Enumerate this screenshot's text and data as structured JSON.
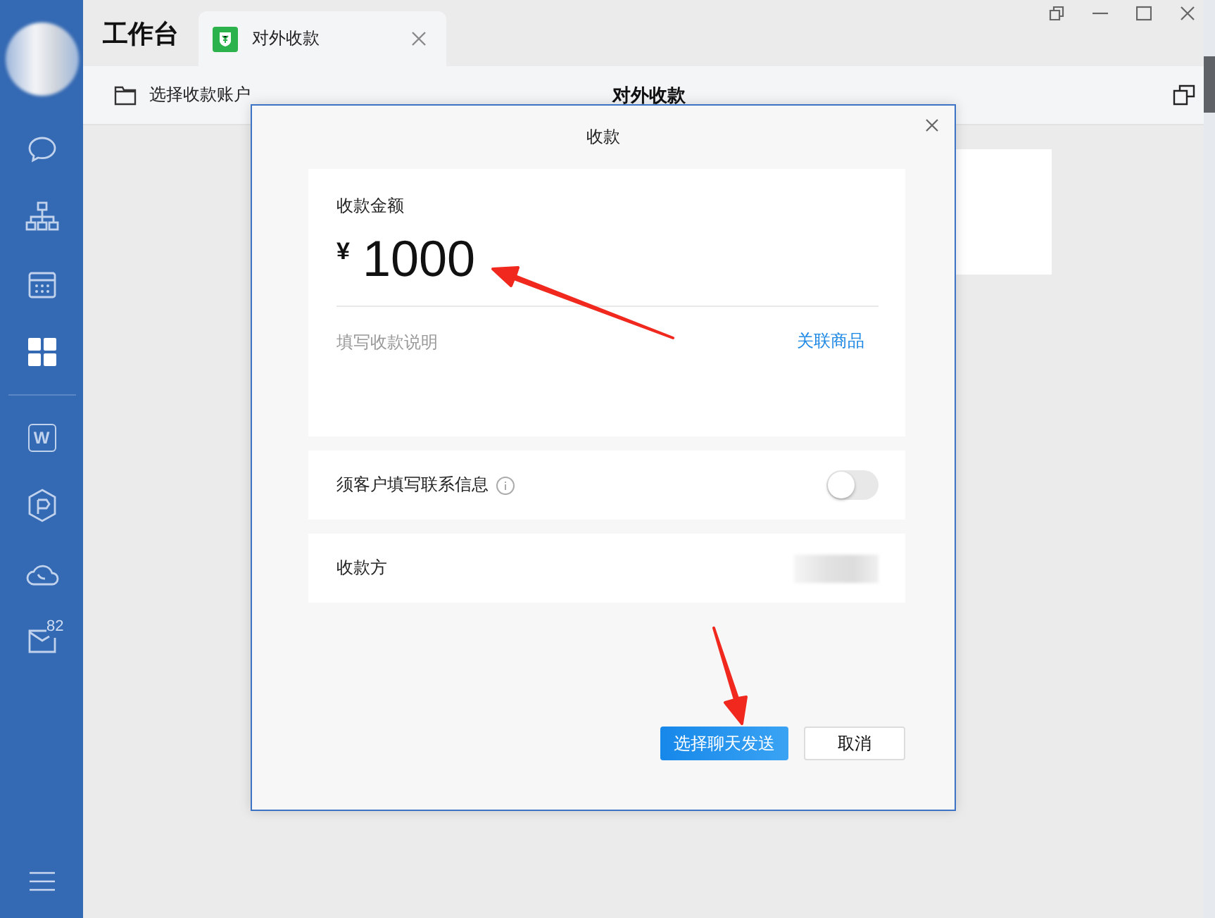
{
  "sidebar": {
    "items": [
      {
        "kind": "chat",
        "selected": false
      },
      {
        "kind": "org",
        "selected": false
      },
      {
        "kind": "calendar",
        "selected": false
      },
      {
        "kind": "apps",
        "selected": true
      },
      {
        "kind": "doc",
        "glyph": "W",
        "selected": false
      },
      {
        "kind": "hexagon",
        "selected": false
      },
      {
        "kind": "cloud",
        "selected": false
      },
      {
        "kind": "mail",
        "badge": "82",
        "selected": false
      }
    ]
  },
  "workspace": {
    "title": "工作台",
    "tabs": [
      {
        "label": "对外收款",
        "selected": true
      }
    ]
  },
  "toolbar": {
    "account_button": "选择收款账户",
    "title": "对外收款"
  },
  "dialog": {
    "title": "收款",
    "amount": {
      "label": "收款金额",
      "currency": "¥",
      "value": "1000"
    },
    "description": {
      "placeholder": "填写收款说明"
    },
    "link": "关联商品",
    "contact_option": {
      "label": "须客户填写联系信息",
      "on": false
    },
    "payee": {
      "label": "收款方"
    },
    "buttons": [
      {
        "label": "选择聊天发送",
        "kind": "primary"
      },
      {
        "label": "取消",
        "kind": "secondary"
      }
    ]
  }
}
